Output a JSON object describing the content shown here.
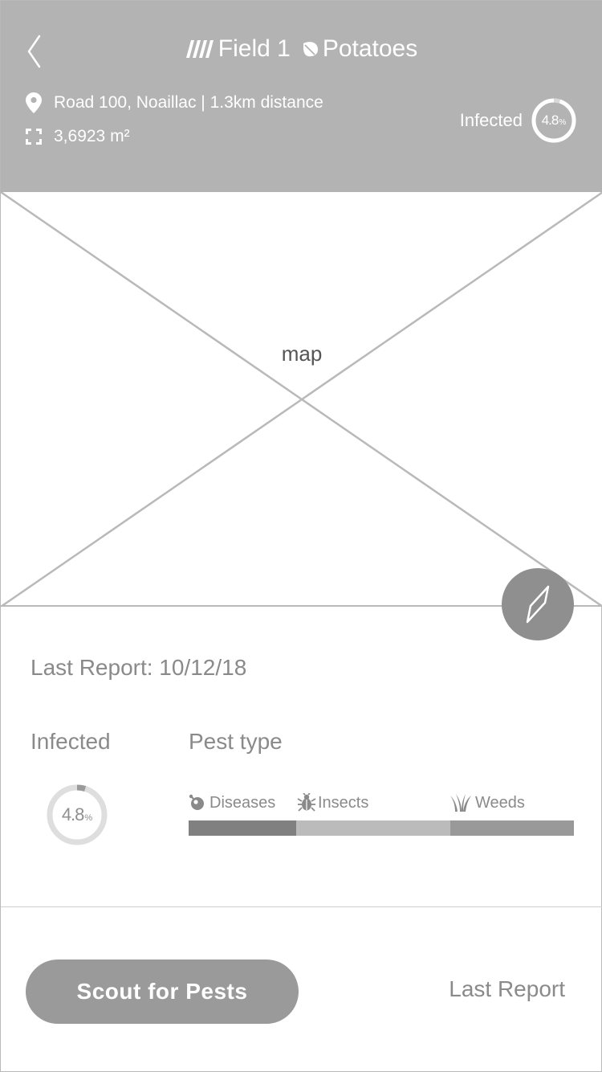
{
  "header": {
    "field_name": "Field 1",
    "crop": "Potatoes",
    "location": "Road 100, Noaillac | 1.3km distance",
    "area": "3,6923 m²",
    "infected_label": "Infected",
    "infected_value": "4.8",
    "infected_unit": "%",
    "infected_fraction": 0.048
  },
  "map": {
    "label": "map"
  },
  "report": {
    "last_report": "Last Report: 10/12/18",
    "infected_label": "Infected",
    "infected_value": "4.8",
    "infected_unit": "%",
    "infected_fraction": 0.048,
    "pest_type_label": "Pest type",
    "pests": [
      {
        "name": "Diseases",
        "icon": "virus-icon",
        "share": 0.28,
        "color": "#808080"
      },
      {
        "name": "Insects",
        "icon": "bug-icon",
        "share": 0.4,
        "color": "#bbbbbb"
      },
      {
        "name": "Weeds",
        "icon": "grass-icon",
        "share": 0.32,
        "color": "#999999"
      }
    ]
  },
  "footer": {
    "scout_button": "Scout for Pests",
    "last_report_link": "Last Report"
  },
  "colors": {
    "header_bg": "#b3b3b3",
    "button_bg": "#9a9a9a",
    "compass_bg": "#8f8f8f"
  }
}
